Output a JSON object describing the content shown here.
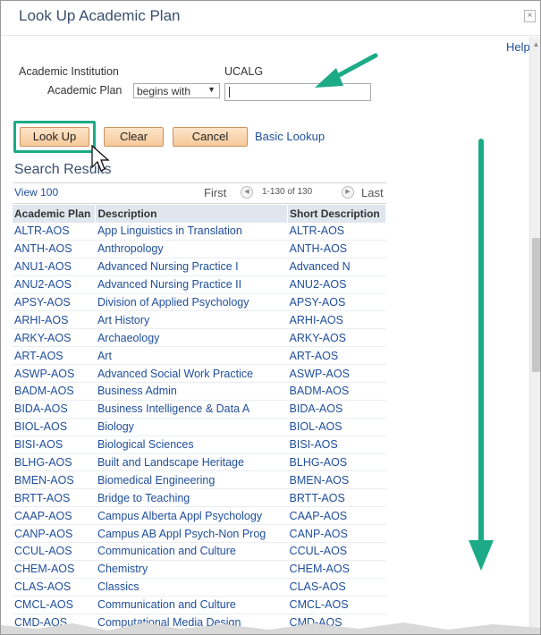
{
  "dialog": {
    "title": "Look Up Academic Plan",
    "close_label": "×",
    "help_label": "Help"
  },
  "criteria": {
    "institution_label": "Academic Institution",
    "institution_value": "UCALG",
    "plan_label": "Academic Plan",
    "operator_value": "begins with",
    "plan_value": ""
  },
  "buttons": {
    "lookup": "Look Up",
    "clear": "Clear",
    "cancel": "Cancel",
    "basic_lookup": "Basic Lookup"
  },
  "results": {
    "heading": "Search Results",
    "view_all": "View 100",
    "first": "First",
    "range": "1-130 of 130",
    "last": "Last",
    "columns": [
      "Academic Plan",
      "Description",
      "Short Description"
    ],
    "rows": [
      [
        "ALTR-AOS",
        "App Linguistics in Translation",
        "ALTR-AOS"
      ],
      [
        "ANTH-AOS",
        "Anthropology",
        "ANTH-AOS"
      ],
      [
        "ANU1-AOS",
        "Advanced Nursing Practice I",
        "Advanced N"
      ],
      [
        "ANU2-AOS",
        "Advanced Nursing Practice II",
        "ANU2-AOS"
      ],
      [
        "APSY-AOS",
        "Division of Applied Psychology",
        "APSY-AOS"
      ],
      [
        "ARHI-AOS",
        "Art History",
        "ARHI-AOS"
      ],
      [
        "ARKY-AOS",
        "Archaeology",
        "ARKY-AOS"
      ],
      [
        "ART-AOS",
        "Art",
        "ART-AOS"
      ],
      [
        "ASWP-AOS",
        "Advanced Social Work Practice",
        "ASWP-AOS"
      ],
      [
        "BADM-AOS",
        "Business Admin",
        "BADM-AOS"
      ],
      [
        "BIDA-AOS",
        "Business Intelligence & Data A",
        "BIDA-AOS"
      ],
      [
        "BIOL-AOS",
        "Biology",
        "BIOL-AOS"
      ],
      [
        "BISI-AOS",
        "Biological Sciences",
        "BISI-AOS"
      ],
      [
        "BLHG-AOS",
        "Built and Landscape Heritage",
        "BLHG-AOS"
      ],
      [
        "BMEN-AOS",
        "Biomedical Engineering",
        "BMEN-AOS"
      ],
      [
        "BRTT-AOS",
        "Bridge to Teaching",
        "BRTT-AOS"
      ],
      [
        "CAAP-AOS",
        "Campus Alberta Appl Psychology",
        "CAAP-AOS"
      ],
      [
        "CANP-AOS",
        "Campus AB Appl Psych-Non Prog",
        "CANP-AOS"
      ],
      [
        "CCUL-AOS",
        "Communication and Culture",
        "CCUL-AOS"
      ],
      [
        "CHEM-AOS",
        "Chemistry",
        "CHEM-AOS"
      ],
      [
        "CLAS-AOS",
        "Classics",
        "CLAS-AOS"
      ],
      [
        "CMCL-AOS",
        "Communication and Culture",
        "CMCL-AOS"
      ],
      [
        "CMD-AOS",
        "Computational Media Design",
        "CMD-AOS"
      ]
    ]
  },
  "colors": {
    "accent_green": "#1bab86",
    "link_blue": "#1f4e9c",
    "button_orange": "#f6c99a"
  },
  "icons": [
    "close-icon",
    "select-arrow-icon",
    "prev-page-icon",
    "next-page-icon",
    "mouse-cursor-icon",
    "scroll-up-icon"
  ]
}
